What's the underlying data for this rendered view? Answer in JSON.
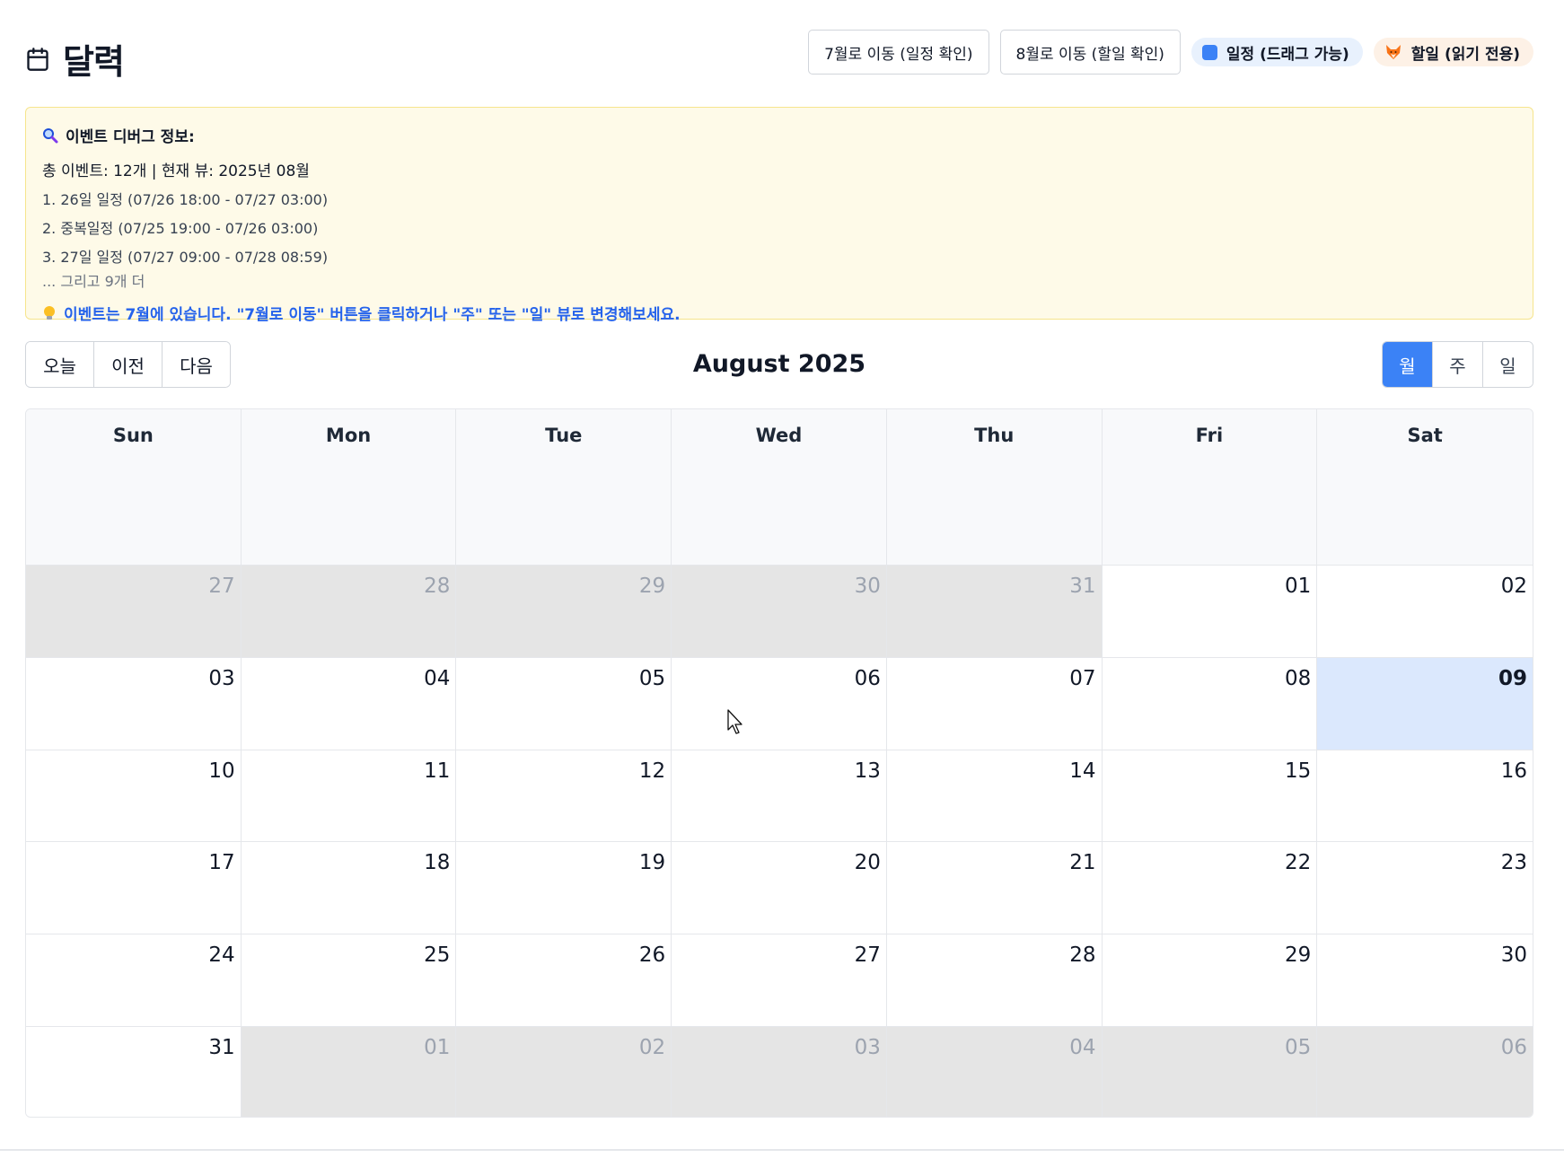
{
  "header": {
    "title": "달력",
    "buttons": [
      "7월로 이동 (일정 확인)",
      "8월로 이동 (할일 확인)"
    ],
    "legend": [
      {
        "label": "일정 (드래그 가능)",
        "color": "#3b82f6"
      },
      {
        "label": "할일 (읽기 전용)",
        "color": "#f97316"
      }
    ]
  },
  "debug": {
    "heading": "이벤트 디버그 정보:",
    "summary": "총 이벤트: 12개 | 현재 뷰: 2025년 08월",
    "items": [
      "1. 26일 일정 (07/26 18:00 - 07/27 03:00)",
      "2. 중복일정 (07/25 19:00 - 07/26 03:00)",
      "3. 27일 일정 (07/27 09:00 - 07/28 08:59)"
    ],
    "more": "... 그리고 9개 더",
    "tip": "이벤트는 7월에 있습니다. \"7월로 이동\" 버튼을 클릭하거나 \"주\" 또는 \"일\" 뷰로 변경해보세요."
  },
  "toolbar": {
    "today": "오늘",
    "prev": "이전",
    "next": "다음",
    "month_title": "August 2025",
    "views": [
      "월",
      "주",
      "일"
    ],
    "active_view": "월"
  },
  "calendar": {
    "weekdays": [
      "Sun",
      "Mon",
      "Tue",
      "Wed",
      "Thu",
      "Fri",
      "Sat"
    ],
    "weeks": [
      [
        {
          "d": "27",
          "other": true
        },
        {
          "d": "28",
          "other": true
        },
        {
          "d": "29",
          "other": true
        },
        {
          "d": "30",
          "other": true
        },
        {
          "d": "31",
          "other": true
        },
        {
          "d": "01"
        },
        {
          "d": "02"
        }
      ],
      [
        {
          "d": "03"
        },
        {
          "d": "04"
        },
        {
          "d": "05"
        },
        {
          "d": "06"
        },
        {
          "d": "07"
        },
        {
          "d": "08"
        },
        {
          "d": "09",
          "today": true
        }
      ],
      [
        {
          "d": "10"
        },
        {
          "d": "11"
        },
        {
          "d": "12"
        },
        {
          "d": "13"
        },
        {
          "d": "14"
        },
        {
          "d": "15"
        },
        {
          "d": "16"
        }
      ],
      [
        {
          "d": "17"
        },
        {
          "d": "18"
        },
        {
          "d": "19"
        },
        {
          "d": "20"
        },
        {
          "d": "21"
        },
        {
          "d": "22"
        },
        {
          "d": "23"
        }
      ],
      [
        {
          "d": "24"
        },
        {
          "d": "25"
        },
        {
          "d": "26"
        },
        {
          "d": "27"
        },
        {
          "d": "28"
        },
        {
          "d": "29"
        },
        {
          "d": "30"
        }
      ],
      [
        {
          "d": "31"
        },
        {
          "d": "01",
          "other": true
        },
        {
          "d": "02",
          "other": true
        },
        {
          "d": "03",
          "other": true
        },
        {
          "d": "04",
          "other": true
        },
        {
          "d": "05",
          "other": true
        },
        {
          "d": "06",
          "other": true
        }
      ]
    ]
  },
  "colors": {
    "accent": "#3b82f6",
    "today_bg": "#dbe8fd",
    "other_month_bg": "#e5e5e5",
    "debug_bg": "#fefae8",
    "tip_text": "#2563eb"
  }
}
